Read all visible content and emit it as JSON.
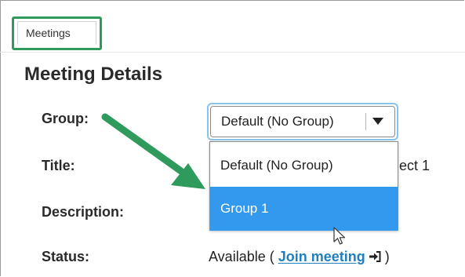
{
  "tabs": {
    "meetings_label": "Meetings"
  },
  "section": {
    "title": "Meeting Details"
  },
  "fields": {
    "group_label": "Group:",
    "title_label": "Title:",
    "description_label": "Description:",
    "status_label": "Status:",
    "title_value_visible": "ject 1",
    "status_prefix": "Available ( ",
    "join_link_text": "Join meeting",
    "status_suffix": " )"
  },
  "group_select": {
    "selected_value": "Default (No Group)",
    "options": [
      "Default (No Group)",
      "Group 1"
    ],
    "highlighted_option": "Group 1"
  },
  "icons": {
    "dropdown_caret": "chevron-down-icon",
    "join": "sign-in-arrow-icon",
    "cursor": "mouse-pointer-icon",
    "annotation": "green-annotation-arrow"
  },
  "colors": {
    "annotation_green": "#2e9a5b",
    "highlight_blue": "#3399ee",
    "link_blue": "#1f7fbf",
    "focus_ring": "#86c5e8"
  }
}
